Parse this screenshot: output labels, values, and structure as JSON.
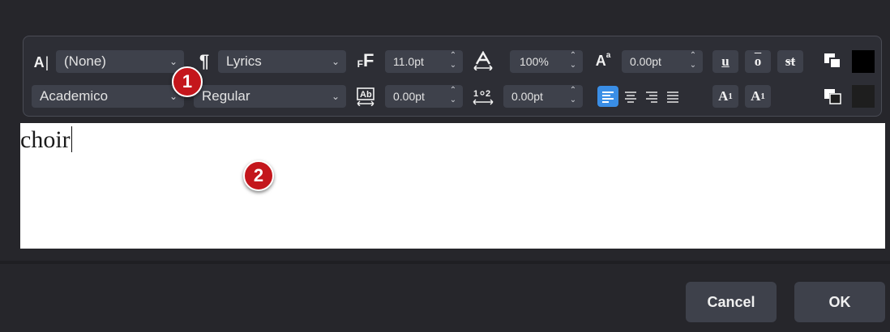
{
  "toolbar": {
    "char_style": "(None)",
    "para_style": "Lyrics",
    "font_family": "Academico",
    "font_style": "Regular",
    "font_size": "11.0pt",
    "char_width": "100%",
    "superscript_offset": "0.00pt",
    "tracking": "0.00pt",
    "line_spacing": "0.00pt",
    "underline_label": "u",
    "overline_label": "o",
    "strikethrough_label": "st",
    "superscript_label": "A",
    "superscript_index": "1",
    "subscript_label": "A",
    "subscript_index": "1",
    "foreground_color": "#000000",
    "background_color": "#1e1e1e"
  },
  "editor": {
    "text": "choir"
  },
  "callouts": [
    "1",
    "2"
  ],
  "buttons": {
    "cancel": "Cancel",
    "ok": "OK"
  }
}
